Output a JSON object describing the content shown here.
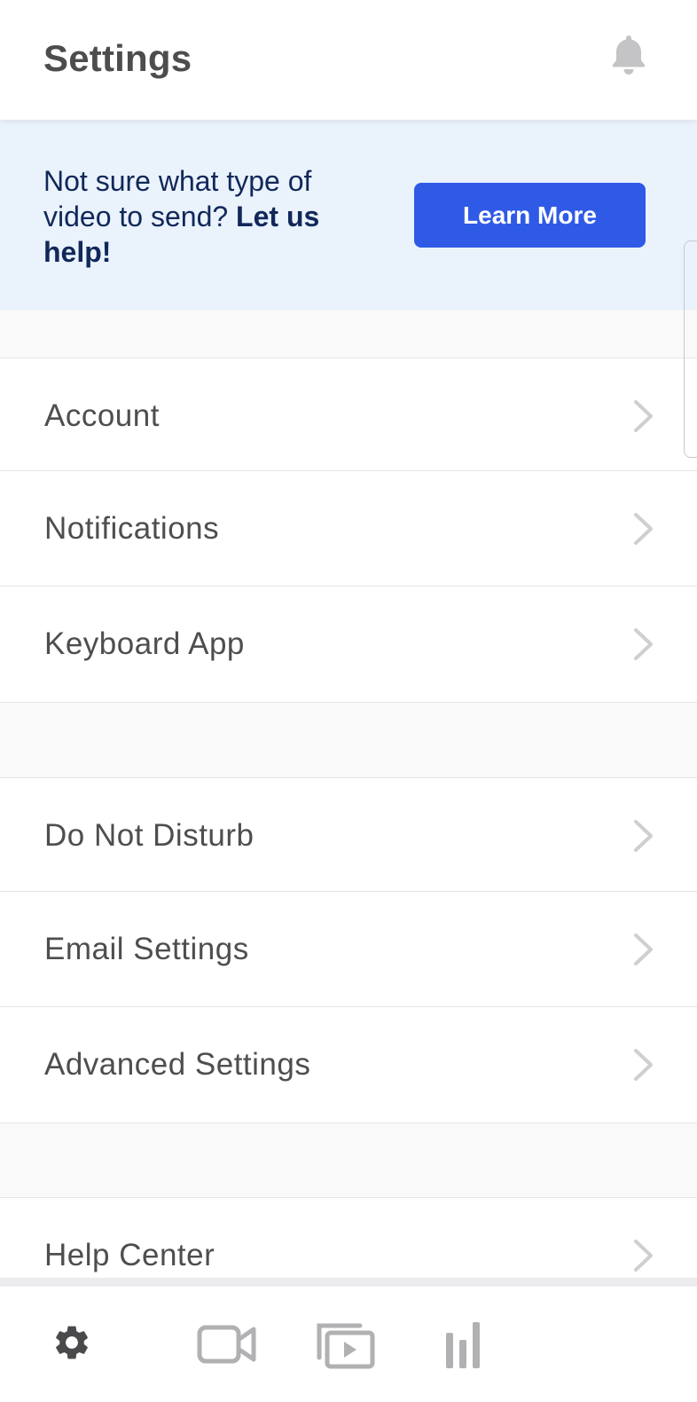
{
  "header": {
    "title": "Settings",
    "notification_icon": "bell-icon"
  },
  "banner": {
    "text": "Not sure what type of video to send?",
    "emphasis": "Let us help!",
    "button_label": "Learn More",
    "button_color": "#2f5ae6",
    "background_color": "#eaf2fc"
  },
  "groups": [
    {
      "items": [
        {
          "label": "Account"
        },
        {
          "label": "Notifications"
        },
        {
          "label": "Keyboard App"
        }
      ]
    },
    {
      "items": [
        {
          "label": "Do Not Disturb"
        },
        {
          "label": "Email Settings"
        },
        {
          "label": "Advanced Settings"
        }
      ]
    },
    {
      "items": [
        {
          "label": "Help Center"
        }
      ]
    }
  ],
  "tabbar": {
    "tabs": [
      {
        "icon": "gear-icon",
        "active": true
      },
      {
        "icon": "video-camera-icon",
        "active": false
      },
      {
        "icon": "video-library-icon",
        "active": false
      },
      {
        "icon": "stats-bars-icon",
        "active": false
      }
    ]
  },
  "colors": {
    "accent": "#2f5ae6",
    "banner_text": "#112859",
    "chevron": "#cfcfd2",
    "divider": "#e6e6e8"
  }
}
